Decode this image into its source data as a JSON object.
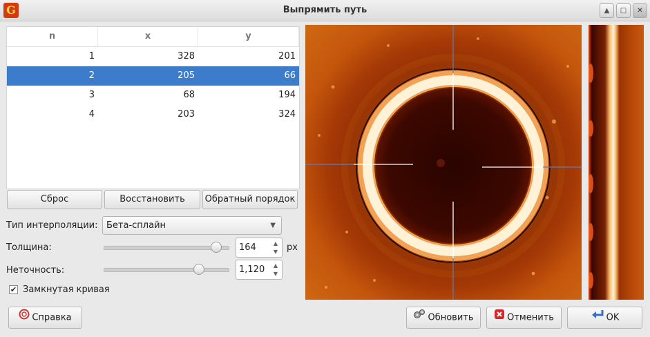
{
  "window": {
    "title": "Выпрямить путь",
    "app_icon": "gwyddion-logo-icon",
    "controls": [
      "roll-up-icon",
      "maximize-icon",
      "close-icon"
    ]
  },
  "table": {
    "headers": [
      "n",
      "x",
      "y"
    ],
    "rows": [
      [
        "1",
        "328",
        "201"
      ],
      [
        "2",
        "205",
        "66"
      ],
      [
        "3",
        "68",
        "194"
      ],
      [
        "4",
        "203",
        "324"
      ]
    ],
    "selected_row": 2
  },
  "buttons": {
    "reset": "Сброс",
    "restore": "Восстановить",
    "reverse": "Обратный порядок",
    "help": "Справка",
    "update": "Обновить",
    "cancel": "Отменить",
    "ok": "OK"
  },
  "interpolation": {
    "label": "Тип интерполяции:",
    "value": "Бета-сплайн"
  },
  "thickness": {
    "label": "Толщина:",
    "value": "164",
    "unit": "px",
    "slider_fraction": 0.9
  },
  "slackness": {
    "label": "Неточность:",
    "value": "1,120",
    "slider_fraction": 0.76
  },
  "closed_curve": {
    "label": "Замкнутая кривая",
    "checked": true
  },
  "colors": {
    "selection": "#3c7ccb",
    "image_dark": "#2a0500",
    "image_ring": "#fff4d8",
    "image_bg": "#c3520b"
  }
}
